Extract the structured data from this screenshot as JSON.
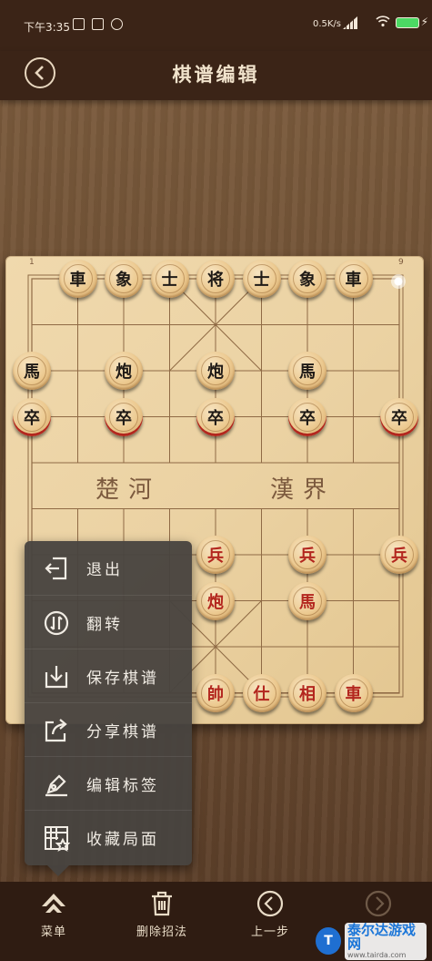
{
  "status_bar": {
    "time": "下午3:35",
    "speed": "0.5K/s"
  },
  "header": {
    "title": "棋谱编辑",
    "back_icon": "chevron-left-icon"
  },
  "board": {
    "river_left": "楚河",
    "river_right": "漢界",
    "corner_left": "1",
    "corner_right": "9",
    "pieces": [
      {
        "char": "車",
        "side": "black"
      },
      {
        "char": "象",
        "side": "black"
      },
      {
        "char": "士",
        "side": "black"
      },
      {
        "char": "将",
        "side": "black"
      },
      {
        "char": "士",
        "side": "black"
      },
      {
        "char": "象",
        "side": "black"
      },
      {
        "char": "車",
        "side": "black"
      },
      {
        "char": "馬",
        "side": "black"
      },
      {
        "char": "炮",
        "side": "black"
      },
      {
        "char": "炮",
        "side": "black"
      },
      {
        "char": "馬",
        "side": "black"
      },
      {
        "char": "卒",
        "side": "black"
      },
      {
        "char": "卒",
        "side": "black"
      },
      {
        "char": "卒",
        "side": "black"
      },
      {
        "char": "卒",
        "side": "black"
      },
      {
        "char": "卒",
        "side": "black"
      },
      {
        "char": "兵",
        "side": "red"
      },
      {
        "char": "兵",
        "side": "red"
      },
      {
        "char": "兵",
        "side": "red"
      },
      {
        "char": "炮",
        "side": "red"
      },
      {
        "char": "馬",
        "side": "red"
      },
      {
        "char": "帥",
        "side": "red"
      },
      {
        "char": "仕",
        "side": "red"
      },
      {
        "char": "相",
        "side": "red"
      },
      {
        "char": "車",
        "side": "red"
      }
    ]
  },
  "menu": {
    "items": [
      {
        "label": "退出",
        "icon": "exit-icon"
      },
      {
        "label": "翻转",
        "icon": "flip-icon"
      },
      {
        "label": "保存棋谱",
        "icon": "download-save-icon"
      },
      {
        "label": "分享棋谱",
        "icon": "share-icon"
      },
      {
        "label": "编辑标签",
        "icon": "pen-icon"
      },
      {
        "label": "收藏局面",
        "icon": "favorite-board-icon"
      }
    ]
  },
  "toolbar": {
    "menu_label": "菜单",
    "delete_label": "删除招法",
    "prev_label": "上一步",
    "next_label": ""
  },
  "watermark": {
    "brand": "泰尔达游戏网",
    "url": "www.tairda.com"
  },
  "colors": {
    "header_bg": "#3b2417",
    "board": "#ebd2a3",
    "red_piece_text": "#b3261e",
    "black_piece_text": "#1f1a16",
    "menu_bg": "#484440"
  }
}
